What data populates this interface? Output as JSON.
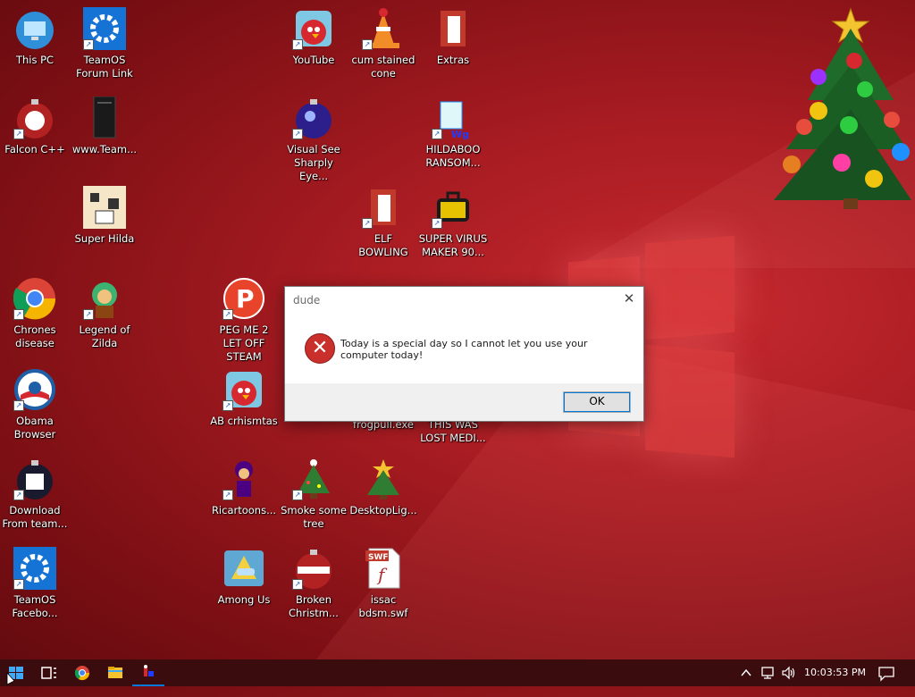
{
  "desktop": {
    "icons": [
      {
        "label": "This PC"
      },
      {
        "label": "TeamOS Forum Link"
      },
      {
        "label": "Falcon C++"
      },
      {
        "label": "www.Team..."
      },
      {
        "label": "Super Hilda"
      },
      {
        "label": "Chrones disease"
      },
      {
        "label": "Legend of Zilda"
      },
      {
        "label": "Obama Browser"
      },
      {
        "label": "Download From team..."
      },
      {
        "label": "TeamOS Facebo..."
      },
      {
        "label": "PEG ME 2 LET OFF STEAM"
      },
      {
        "label": "AB crhismtas"
      },
      {
        "label": "Ricartoons..."
      },
      {
        "label": "Among Us"
      },
      {
        "label": "YouTube"
      },
      {
        "label": "Visual See Sharply Eye..."
      },
      {
        "label": "Smoke some tree"
      },
      {
        "label": "Broken Christm..."
      },
      {
        "label": "cum stained cone"
      },
      {
        "label": "ELF BOWLING"
      },
      {
        "label": "frogpull.exe"
      },
      {
        "label": "DesktopLig..."
      },
      {
        "label": "issac bdsm.swf"
      },
      {
        "label": "Extras"
      },
      {
        "label": "HILDABOO RANSOM..."
      },
      {
        "label": "SUPER VIRUS MAKER 90..."
      },
      {
        "label": "THIS WAS LOST MEDI..."
      }
    ],
    "swf_badge": "SWF"
  },
  "dialog": {
    "title": "dude",
    "message": "Today is a special day so I cannot let you use your computer today!",
    "ok_label": "OK",
    "close_glyph": "✕",
    "error_glyph": "✕"
  },
  "taskbar": {
    "clock": "10:03:53 PM",
    "accent": "#0078d7"
  },
  "colors": {
    "wallpaper": "#a81c22",
    "taskbar": "#3a0c0e",
    "dialog_footer": "#f0f0f0"
  }
}
